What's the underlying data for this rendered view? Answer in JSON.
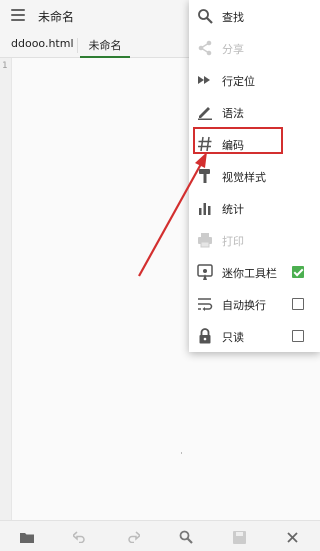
{
  "appbar": {
    "title": "未命名"
  },
  "tabs": [
    {
      "label": "ddooo.html"
    },
    {
      "label": "未命名"
    }
  ],
  "editor": {
    "line_number": "1"
  },
  "menu": {
    "items": [
      {
        "label": "查找",
        "icon": "search-icon"
      },
      {
        "label": "分享",
        "icon": "share-icon",
        "disabled": true
      },
      {
        "label": "行定位",
        "icon": "fast-forward-icon"
      },
      {
        "label": "语法",
        "icon": "pen-icon"
      },
      {
        "label": "编码",
        "icon": "hash-icon",
        "highlighted": true
      },
      {
        "label": "视觉样式",
        "icon": "brush-icon"
      },
      {
        "label": "统计",
        "icon": "bar-chart-icon"
      },
      {
        "label": "打印",
        "icon": "print-icon",
        "disabled": true
      },
      {
        "label": "迷你工具栏",
        "icon": "mini-toolbar-icon",
        "checked": true
      },
      {
        "label": "自动换行",
        "icon": "wrap-icon",
        "checked": false
      },
      {
        "label": "只读",
        "icon": "lock-icon",
        "checked": false
      }
    ]
  },
  "bottombar": {
    "icons": [
      "folder-icon",
      "undo-icon",
      "redo-icon",
      "search-icon",
      "save-icon",
      "close-icon"
    ]
  },
  "colors": {
    "accent_green": "#4caf50",
    "highlight_red": "#d32f2f",
    "tab_underline": "#2e7d32"
  }
}
